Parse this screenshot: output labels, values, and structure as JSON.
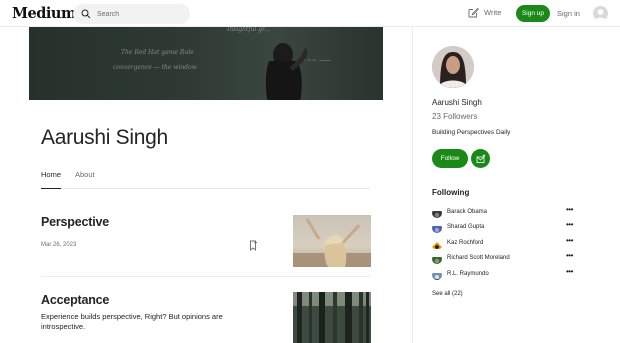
{
  "header": {
    "logo": "Medium",
    "search_placeholder": "Search",
    "write_label": "Write",
    "signup_label": "Sign up",
    "signin_label": "Sign in"
  },
  "profile": {
    "name": "Aarushi Singh",
    "followers": "23 Followers",
    "bio": "Building Perspectives Daily",
    "follow_label": "Follow"
  },
  "tabs": [
    {
      "label": "Home",
      "active": true
    },
    {
      "label": "About",
      "active": false
    }
  ],
  "posts": [
    {
      "title": "Perspective",
      "date": "Mar 26, 2023"
    },
    {
      "title": "Acceptance",
      "excerpt": "Experience builds perspective, Right? But opinions are introspective."
    }
  ],
  "following": {
    "heading": "Following",
    "items": [
      {
        "name": "Barack Obama"
      },
      {
        "name": "Sharad Gupta"
      },
      {
        "name": "Kaz Rochford"
      },
      {
        "name": "Richard Scott Moreland"
      },
      {
        "name": "R.L. Raymundo"
      }
    ],
    "see_all": "See all (22)"
  },
  "colors": {
    "accent": "#1a8917",
    "text": "#242424",
    "muted": "#6b6b6b"
  }
}
